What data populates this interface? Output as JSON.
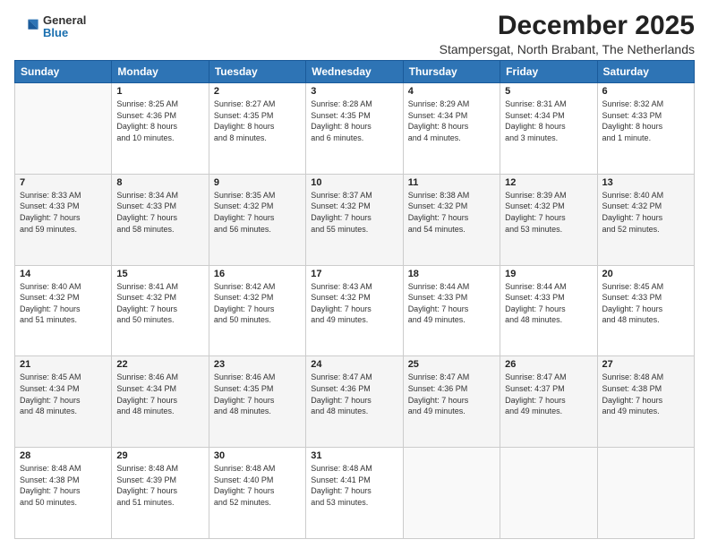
{
  "logo": {
    "general": "General",
    "blue": "Blue"
  },
  "title": "December 2025",
  "subtitle": "Stampersgat, North Brabant, The Netherlands",
  "days_header": [
    "Sunday",
    "Monday",
    "Tuesday",
    "Wednesday",
    "Thursday",
    "Friday",
    "Saturday"
  ],
  "weeks": [
    [
      {
        "num": "",
        "info": ""
      },
      {
        "num": "1",
        "info": "Sunrise: 8:25 AM\nSunset: 4:36 PM\nDaylight: 8 hours\nand 10 minutes."
      },
      {
        "num": "2",
        "info": "Sunrise: 8:27 AM\nSunset: 4:35 PM\nDaylight: 8 hours\nand 8 minutes."
      },
      {
        "num": "3",
        "info": "Sunrise: 8:28 AM\nSunset: 4:35 PM\nDaylight: 8 hours\nand 6 minutes."
      },
      {
        "num": "4",
        "info": "Sunrise: 8:29 AM\nSunset: 4:34 PM\nDaylight: 8 hours\nand 4 minutes."
      },
      {
        "num": "5",
        "info": "Sunrise: 8:31 AM\nSunset: 4:34 PM\nDaylight: 8 hours\nand 3 minutes."
      },
      {
        "num": "6",
        "info": "Sunrise: 8:32 AM\nSunset: 4:33 PM\nDaylight: 8 hours\nand 1 minute."
      }
    ],
    [
      {
        "num": "7",
        "info": "Sunrise: 8:33 AM\nSunset: 4:33 PM\nDaylight: 7 hours\nand 59 minutes."
      },
      {
        "num": "8",
        "info": "Sunrise: 8:34 AM\nSunset: 4:33 PM\nDaylight: 7 hours\nand 58 minutes."
      },
      {
        "num": "9",
        "info": "Sunrise: 8:35 AM\nSunset: 4:32 PM\nDaylight: 7 hours\nand 56 minutes."
      },
      {
        "num": "10",
        "info": "Sunrise: 8:37 AM\nSunset: 4:32 PM\nDaylight: 7 hours\nand 55 minutes."
      },
      {
        "num": "11",
        "info": "Sunrise: 8:38 AM\nSunset: 4:32 PM\nDaylight: 7 hours\nand 54 minutes."
      },
      {
        "num": "12",
        "info": "Sunrise: 8:39 AM\nSunset: 4:32 PM\nDaylight: 7 hours\nand 53 minutes."
      },
      {
        "num": "13",
        "info": "Sunrise: 8:40 AM\nSunset: 4:32 PM\nDaylight: 7 hours\nand 52 minutes."
      }
    ],
    [
      {
        "num": "14",
        "info": "Sunrise: 8:40 AM\nSunset: 4:32 PM\nDaylight: 7 hours\nand 51 minutes."
      },
      {
        "num": "15",
        "info": "Sunrise: 8:41 AM\nSunset: 4:32 PM\nDaylight: 7 hours\nand 50 minutes."
      },
      {
        "num": "16",
        "info": "Sunrise: 8:42 AM\nSunset: 4:32 PM\nDaylight: 7 hours\nand 50 minutes."
      },
      {
        "num": "17",
        "info": "Sunrise: 8:43 AM\nSunset: 4:32 PM\nDaylight: 7 hours\nand 49 minutes."
      },
      {
        "num": "18",
        "info": "Sunrise: 8:44 AM\nSunset: 4:33 PM\nDaylight: 7 hours\nand 49 minutes."
      },
      {
        "num": "19",
        "info": "Sunrise: 8:44 AM\nSunset: 4:33 PM\nDaylight: 7 hours\nand 48 minutes."
      },
      {
        "num": "20",
        "info": "Sunrise: 8:45 AM\nSunset: 4:33 PM\nDaylight: 7 hours\nand 48 minutes."
      }
    ],
    [
      {
        "num": "21",
        "info": "Sunrise: 8:45 AM\nSunset: 4:34 PM\nDaylight: 7 hours\nand 48 minutes."
      },
      {
        "num": "22",
        "info": "Sunrise: 8:46 AM\nSunset: 4:34 PM\nDaylight: 7 hours\nand 48 minutes."
      },
      {
        "num": "23",
        "info": "Sunrise: 8:46 AM\nSunset: 4:35 PM\nDaylight: 7 hours\nand 48 minutes."
      },
      {
        "num": "24",
        "info": "Sunrise: 8:47 AM\nSunset: 4:36 PM\nDaylight: 7 hours\nand 48 minutes."
      },
      {
        "num": "25",
        "info": "Sunrise: 8:47 AM\nSunset: 4:36 PM\nDaylight: 7 hours\nand 49 minutes."
      },
      {
        "num": "26",
        "info": "Sunrise: 8:47 AM\nSunset: 4:37 PM\nDaylight: 7 hours\nand 49 minutes."
      },
      {
        "num": "27",
        "info": "Sunrise: 8:48 AM\nSunset: 4:38 PM\nDaylight: 7 hours\nand 49 minutes."
      }
    ],
    [
      {
        "num": "28",
        "info": "Sunrise: 8:48 AM\nSunset: 4:38 PM\nDaylight: 7 hours\nand 50 minutes."
      },
      {
        "num": "29",
        "info": "Sunrise: 8:48 AM\nSunset: 4:39 PM\nDaylight: 7 hours\nand 51 minutes."
      },
      {
        "num": "30",
        "info": "Sunrise: 8:48 AM\nSunset: 4:40 PM\nDaylight: 7 hours\nand 52 minutes."
      },
      {
        "num": "31",
        "info": "Sunrise: 8:48 AM\nSunset: 4:41 PM\nDaylight: 7 hours\nand 53 minutes."
      },
      {
        "num": "",
        "info": ""
      },
      {
        "num": "",
        "info": ""
      },
      {
        "num": "",
        "info": ""
      }
    ]
  ]
}
